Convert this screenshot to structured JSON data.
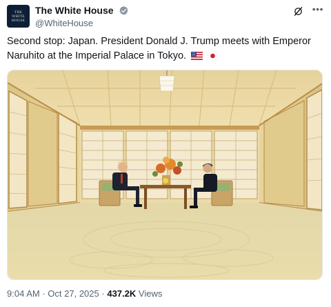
{
  "account": {
    "display_name": "The White House",
    "handle": "@WhiteHouse",
    "avatar_text": [
      "THE",
      "WHITE",
      "HOUSE"
    ]
  },
  "tweet": {
    "text": "Second stop: Japan. President Donald J. Trump meets with Emperor Naruhito at the Imperial Palace in Tokyo.",
    "flags": [
      "us-flag-icon",
      "japan-flag-icon"
    ]
  },
  "meta": {
    "time": "9:04 AM",
    "separator": "·",
    "date": "Oct 27, 2025",
    "views_count": "437.2K",
    "views_label": "Views"
  },
  "icons": {
    "verified": "verified-badge-icon",
    "grok": "grok-icon",
    "more": "more-options-icon"
  },
  "colors": {
    "verified_badge": "#8e96a0",
    "secondary_text": "#536471",
    "avatar_bg": "#0c1f36"
  }
}
